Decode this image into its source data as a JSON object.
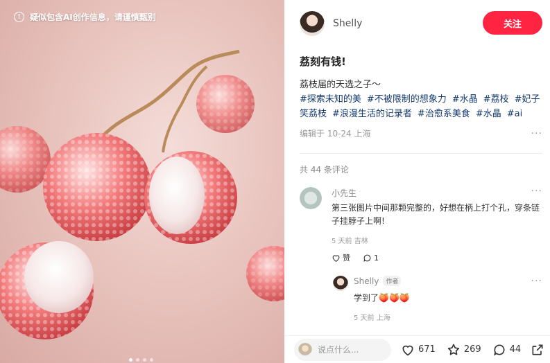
{
  "media": {
    "ai_notice": "疑似包含AI创作信息，请谨慎甄别",
    "carousel": {
      "total": 4,
      "active": 1
    }
  },
  "author": {
    "name": "Shelly",
    "follow_label": "关注"
  },
  "note": {
    "title": "荔刻有钱!",
    "description": "荔枝届的天选之子～",
    "tags": [
      "#探索未知的美",
      "#不被限制的想象力",
      "#水晶",
      "#荔枝",
      "#妃子笑荔枝",
      "#浪漫生活的记录者",
      "#治愈系美食",
      "#水晶",
      "#ai"
    ],
    "meta": "编辑于 10-24 上海",
    "more": "···"
  },
  "comments": {
    "count_label": "共 44 条评论",
    "items": [
      {
        "name": "小先生",
        "text": "第三张图片中间那颗完整的，好想在柄上打个孔，穿条链子挂脖子上啊!",
        "meta": "5 天前 吉林",
        "like_label": "赞",
        "reply_count": "1",
        "more": "···"
      }
    ],
    "reply": {
      "name": "Shelly",
      "badge": "作者",
      "text": "学到了🍑🍑🍑",
      "meta": "5 天前 上海",
      "more": "···"
    }
  },
  "bottom_bar": {
    "input_placeholder": "说点什么...",
    "likes": "671",
    "collects": "269",
    "comments": "44"
  },
  "colors": {
    "accent": "#ff2442",
    "tag": "#13386c"
  },
  "icons": [
    "info-icon",
    "heart-icon",
    "star-icon",
    "comment-icon",
    "share-icon",
    "chat-icon"
  ]
}
